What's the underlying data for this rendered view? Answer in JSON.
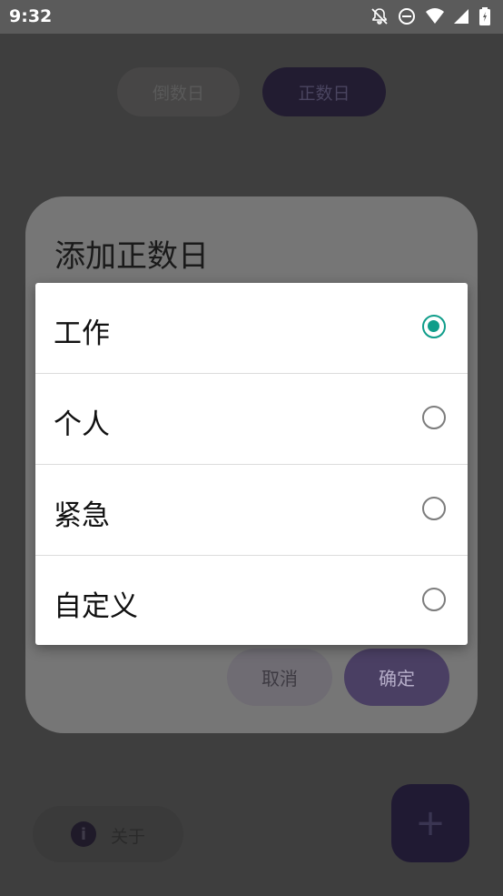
{
  "status_bar": {
    "time": "9:32",
    "icons": [
      "notifications-off-icon",
      "do-not-disturb-icon",
      "wifi-icon",
      "cellular-signal-icon",
      "battery-icon"
    ]
  },
  "segments": {
    "countdown": "倒数日",
    "countup": "正数日"
  },
  "dialog": {
    "title": "添加正数日",
    "cancel_label": "取消",
    "confirm_label": "确定"
  },
  "category_popup": {
    "options": [
      {
        "label": "工作",
        "selected": true
      },
      {
        "label": "个人",
        "selected": false
      },
      {
        "label": "紧急",
        "selected": false
      },
      {
        "label": "自定义",
        "selected": false
      }
    ]
  },
  "bottom": {
    "about_label": "关于",
    "fab_icon": "plus-icon"
  },
  "colors": {
    "accent": "#0f9d8a"
  }
}
